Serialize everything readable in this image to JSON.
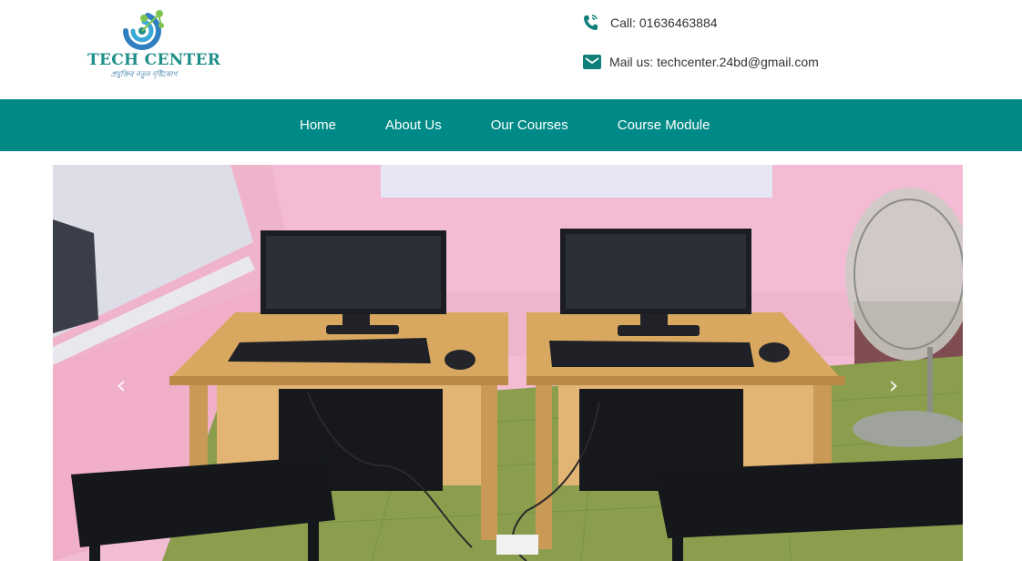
{
  "brand": {
    "name": "TECH CENTER",
    "tagline": "প্রযুক্তির নতুন দৃষ্টিকোণ",
    "accent_color": "#008a87",
    "title_color": "#1f8f8a"
  },
  "contact": {
    "call_label": "Call: 01636463884",
    "call_icon": "phone-icon",
    "mail_label": "Mail us: techcenter.24bd@gmail.com",
    "mail_icon": "envelope-icon"
  },
  "nav": {
    "items": [
      {
        "label": "Home"
      },
      {
        "label": "About Us"
      },
      {
        "label": "Our Courses"
      },
      {
        "label": "Course Module"
      }
    ]
  },
  "carousel": {
    "slide_image": "computer-lab-photo",
    "prev_icon": "chevron-left-icon",
    "next_icon": "chevron-right-icon",
    "prev_glyph": "‹",
    "next_glyph": "›"
  }
}
